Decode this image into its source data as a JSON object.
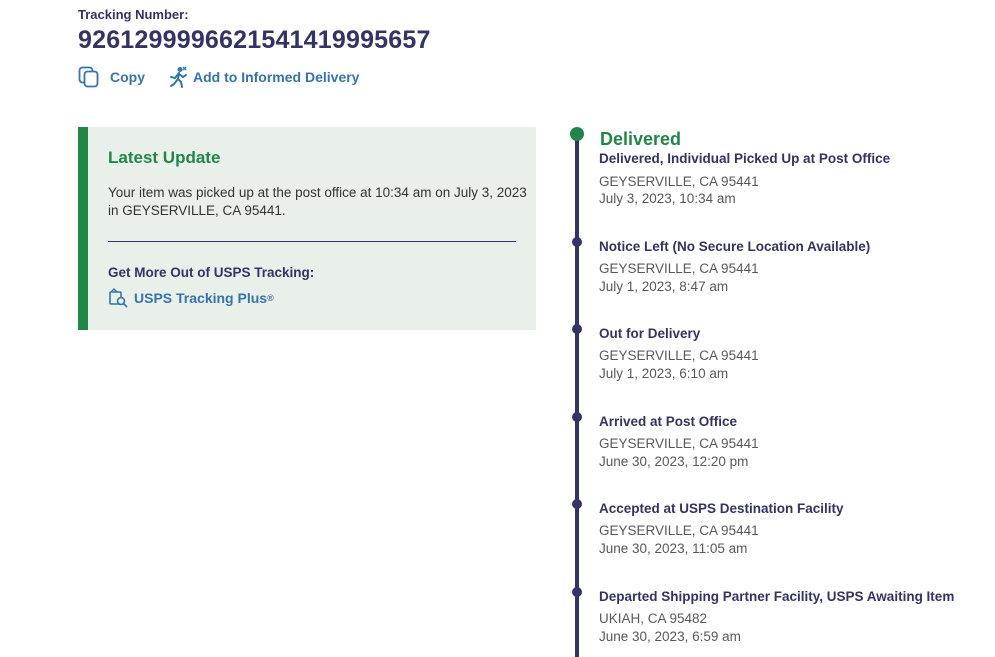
{
  "tracking": {
    "label": "Tracking Number:",
    "number": "9261299996621541419995657"
  },
  "actions": {
    "copy_label": "Copy",
    "copy_icon": "copy-icon",
    "informed_label": "Add to Informed Delivery",
    "informed_icon": "mail-carrier-icon"
  },
  "latest_update": {
    "title": "Latest Update",
    "text": "Your item was picked up at the post office at 10:34 am on July 3, 2023 in GEYSERVILLE, CA 95441.",
    "more_heading": "Get More Out of USPS Tracking:",
    "plus_label": "USPS Tracking Plus",
    "plus_mark": "®",
    "plus_icon": "tracking-plus-icon"
  },
  "colors": {
    "navy": "#333366",
    "green": "#218748",
    "link_blue": "#3573b1",
    "panel_bg": "#e9f0e9",
    "grey_text": "#595959"
  },
  "timeline": {
    "current_status": "Delivered",
    "events": [
      {
        "title": "Delivered, Individual Picked Up at Post Office",
        "location": "GEYSERVILLE, CA 95441",
        "datetime": "July 3, 2023, 10:34 am"
      },
      {
        "title": "Notice Left (No Secure Location Available)",
        "location": "GEYSERVILLE, CA 95441",
        "datetime": "July 1, 2023, 8:47 am"
      },
      {
        "title": "Out for Delivery",
        "location": "GEYSERVILLE, CA 95441",
        "datetime": "July 1, 2023, 6:10 am"
      },
      {
        "title": "Arrived at Post Office",
        "location": "GEYSERVILLE, CA 95441",
        "datetime": "June 30, 2023, 12:20 pm"
      },
      {
        "title": "Accepted at USPS Destination Facility",
        "location": "GEYSERVILLE, CA 95441",
        "datetime": "June 30, 2023, 11:05 am"
      },
      {
        "title": "Departed Shipping Partner Facility, USPS Awaiting Item",
        "location": "UKIAH, CA 95482",
        "datetime": "June 30, 2023, 6:59 am"
      }
    ]
  }
}
